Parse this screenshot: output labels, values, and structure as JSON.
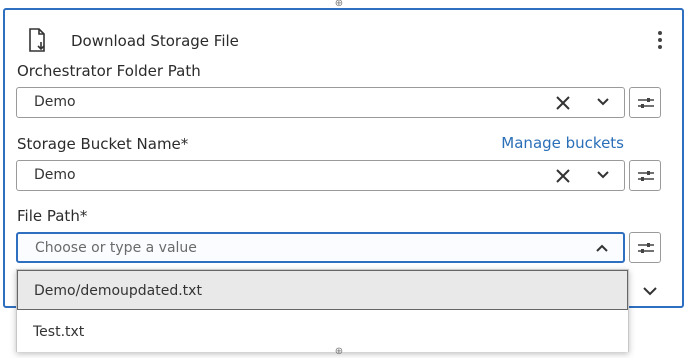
{
  "activity": {
    "title": "Download Storage File",
    "icon": "download-file-icon"
  },
  "fields": {
    "orchestrator_folder_path": {
      "label": "Orchestrator Folder Path",
      "value": "Demo"
    },
    "storage_bucket_name": {
      "label": "Storage Bucket Name*",
      "value": "Demo",
      "link": "Manage buckets"
    },
    "file_path": {
      "label": "File Path*",
      "placeholder": "Choose or type a value"
    }
  },
  "dropdown": {
    "options": [
      {
        "label": "Demo/demoupdated.txt"
      },
      {
        "label": "Test.txt"
      }
    ]
  },
  "colors": {
    "accent": "#2f6fc0",
    "link": "#2a6fb8"
  }
}
